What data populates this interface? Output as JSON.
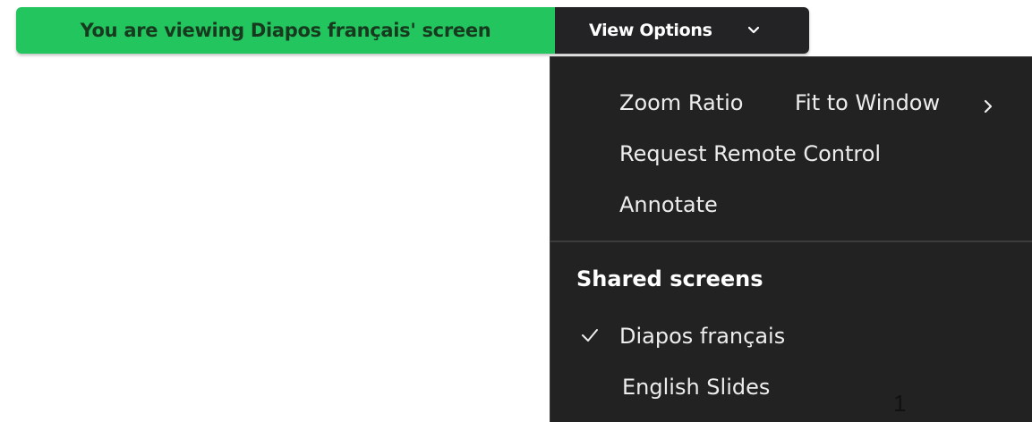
{
  "banner": {
    "status_text": "You are viewing Diapos français' screen",
    "options_label": "View Options",
    "chevron_icon": "chevron-down-icon",
    "colors": {
      "status_bg": "#23c55e",
      "options_bg": "#232325"
    }
  },
  "menu": {
    "zoom_ratio": {
      "label": "Zoom Ratio",
      "value": "Fit to Window",
      "submenu_icon": "chevron-right-icon"
    },
    "request_remote_control": "Request Remote Control",
    "annotate": "Annotate",
    "shared_screens": {
      "heading": "Shared screens",
      "items": [
        {
          "label": "Diapos français",
          "checked": true,
          "icon": "checkmark-icon"
        },
        {
          "label": "English Slides",
          "checked": false
        }
      ]
    },
    "colors": {
      "background": "#222222",
      "text": "#ededed"
    }
  },
  "page_number": "1"
}
